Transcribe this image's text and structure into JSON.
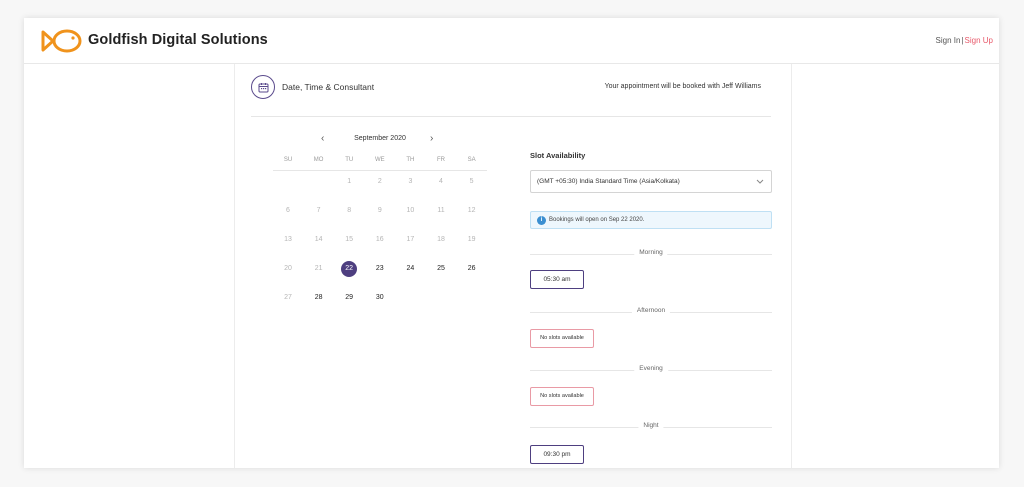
{
  "header": {
    "brand": "Goldfish Digital Solutions",
    "sign_in": "Sign In",
    "separator": "|",
    "sign_up": "Sign Up",
    "logo_icon": "goldfish-logo-icon",
    "logo_color": "#f0931c"
  },
  "step": {
    "icon": "calendar-icon",
    "title": "Date, Time & Consultant",
    "consultant_note": "Your appointment will be booked with Jeff Williams"
  },
  "calendar": {
    "prev_icon": "chevron-left-icon",
    "next_icon": "chevron-right-icon",
    "prev": "‹",
    "next": "›",
    "month_label": "September 2020",
    "weekdays": [
      "SU",
      "MO",
      "TU",
      "WE",
      "TH",
      "FR",
      "SA"
    ],
    "selected_day": "22",
    "days": [
      [
        "",
        "",
        "1",
        "2",
        "3",
        "4",
        "5"
      ],
      [
        "6",
        "7",
        "8",
        "9",
        "10",
        "11",
        "12"
      ],
      [
        "13",
        "14",
        "15",
        "16",
        "17",
        "18",
        "19"
      ],
      [
        "20",
        "21",
        "22",
        "23",
        "24",
        "25",
        "26"
      ],
      [
        "27",
        "28",
        "29",
        "30",
        "",
        "",
        ""
      ]
    ],
    "available_days": [
      "22",
      "23",
      "24",
      "25",
      "26",
      "28",
      "29",
      "30"
    ]
  },
  "slots": {
    "title": "Slot Availability",
    "timezone": "(GMT +05:30) India Standard Time (Asia/Kolkata)",
    "info_icon": "info-icon",
    "info": "Bookings will open on Sep 22 2020.",
    "periods": [
      {
        "label": "Morning",
        "slot": "05:30 am",
        "available": true
      },
      {
        "label": "Afternoon",
        "slot": "No slots available",
        "available": false
      },
      {
        "label": "Evening",
        "slot": "No slots available",
        "available": false
      },
      {
        "label": "Night",
        "slot": "09:30 pm",
        "available": true
      }
    ]
  },
  "colors": {
    "accent": "#4e3f80",
    "sign_up": "#e85a6b",
    "no_slot_border": "#e99aa5",
    "info_bg": "#eef7fd"
  }
}
